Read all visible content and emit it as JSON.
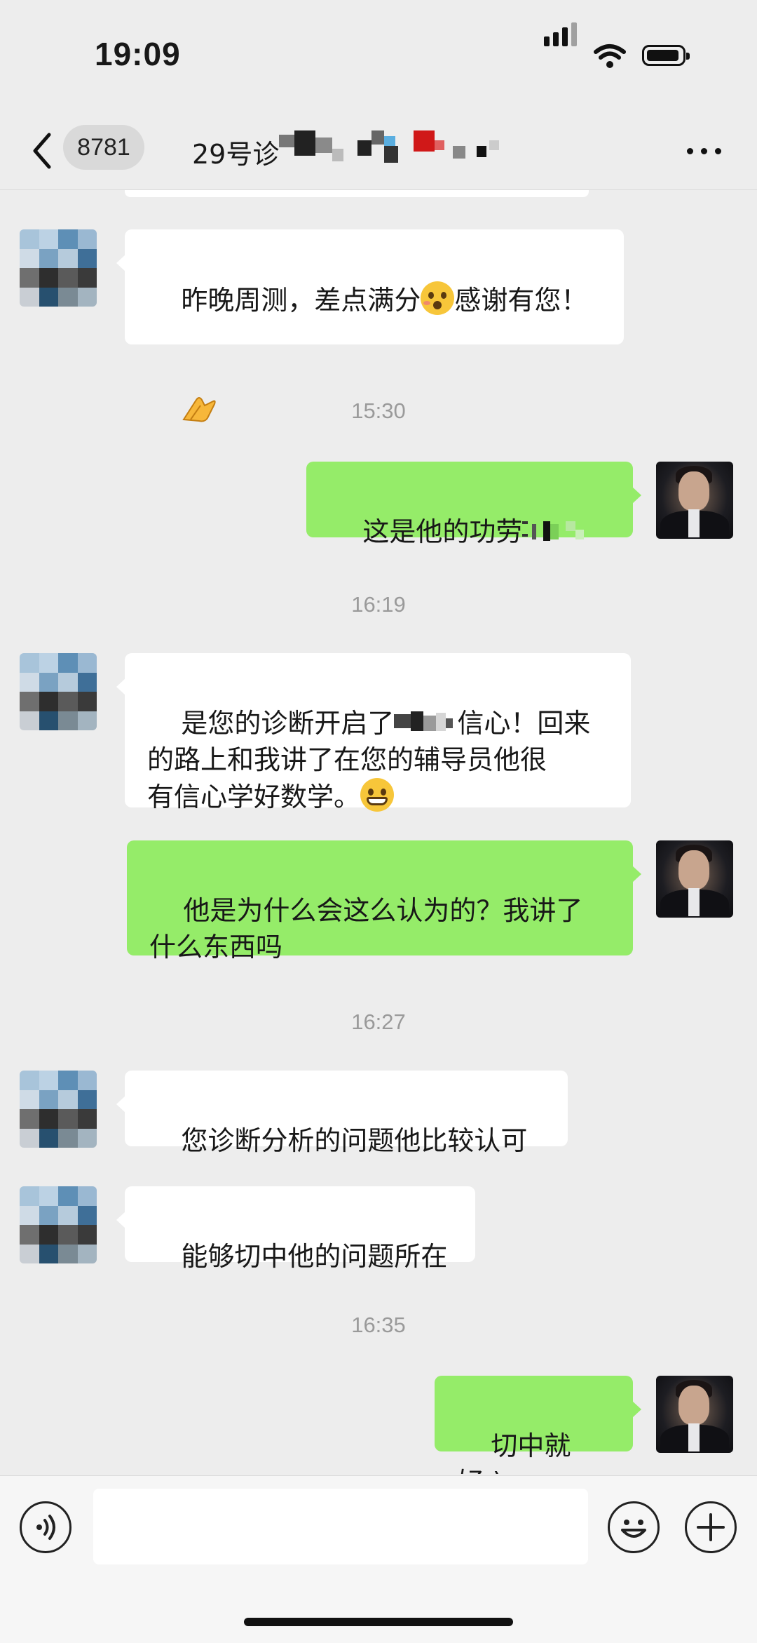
{
  "status_bar": {
    "time": "19:09"
  },
  "nav": {
    "unread_count": "8781",
    "title_visible": "29号诊"
  },
  "messages": [
    {
      "id": "m1",
      "side": "left",
      "text_before": "昨晚周测，差点满分",
      "emoji": "emoji-surprised",
      "text_after": "感谢有您！",
      "trailing_icon": "clap-icon"
    },
    {
      "id": "t1",
      "type": "timestamp",
      "text": "15:30"
    },
    {
      "id": "m2",
      "side": "right",
      "text": "这是他的功劳"
    },
    {
      "id": "t2",
      "type": "timestamp",
      "text": "16:19"
    },
    {
      "id": "m3",
      "side": "left",
      "text_part1": "是您的诊断开启了",
      "text_part2": "信心！回来",
      "text_line2": "的路上和我讲了在您的辅导员他很",
      "text_line3": "有信心学好数学。",
      "emoji": "emoji-grin"
    },
    {
      "id": "m4",
      "side": "right",
      "text": "他是为什么会这么认为的？我讲了\n什么东西吗"
    },
    {
      "id": "t3",
      "type": "timestamp",
      "text": "16:27"
    },
    {
      "id": "m5",
      "side": "left",
      "text": "您诊断分析的问题他比较认可"
    },
    {
      "id": "m6",
      "side": "left",
      "text": "能够切中他的问题所在"
    },
    {
      "id": "t4",
      "type": "timestamp",
      "text": "16:35"
    },
    {
      "id": "m7",
      "side": "right",
      "text": "切中就好:)"
    }
  ],
  "colors": {
    "background": "#ededed",
    "bubble_self": "#95ec69",
    "bubble_other": "#ffffff",
    "timestamp": "#9a9a9a"
  },
  "icons": {
    "back": "chevron-left-icon",
    "more": "more-dots-icon",
    "voice": "voice-icon",
    "emoji": "smiley-icon",
    "plus": "plus-icon"
  }
}
